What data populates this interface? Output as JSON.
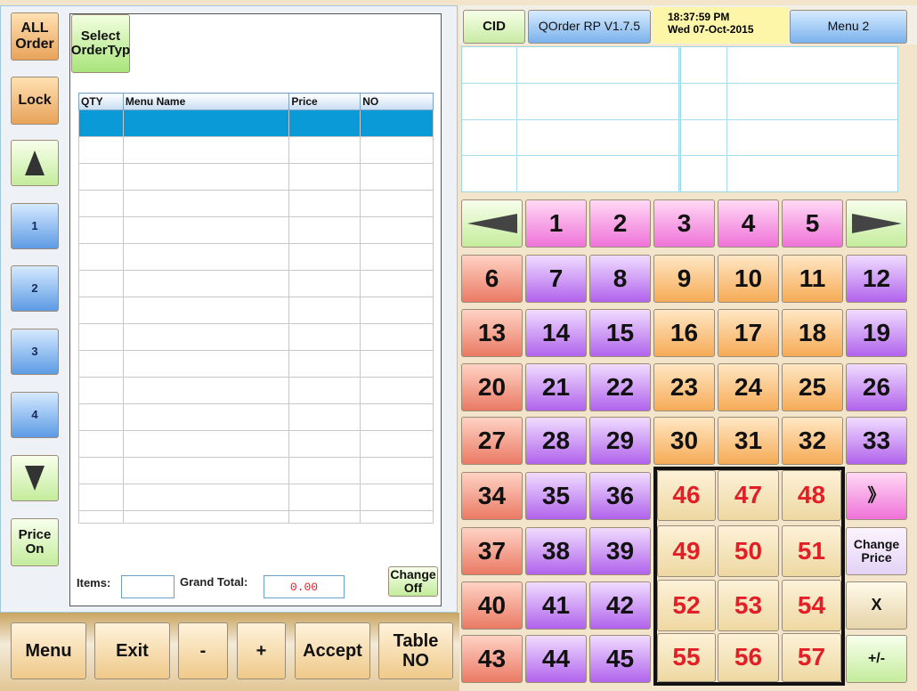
{
  "left_buttons": {
    "all_order": "ALL\nOrder",
    "lock": "Lock",
    "page_1": "1",
    "page_2": "2",
    "page_3": "3",
    "page_4": "4",
    "price_on": "Price\nOn"
  },
  "order": {
    "select_order_type": "Select\nOrderTyp",
    "columns": [
      "QTY",
      "Menu Name",
      "Price",
      "NO"
    ],
    "items_label": "Items:",
    "grand_total_label": "Grand Total:",
    "grand_total_value": "0.00",
    "change_off": "Change\nOff"
  },
  "bottom_buttons": {
    "menu": "Menu",
    "exit": "Exit",
    "minus": "-",
    "plus": "+",
    "accept": "Accept",
    "table_no": "Table\nNO"
  },
  "header": {
    "cid": "CID",
    "version": "QOrder RP V1.7.5",
    "time": "18:37:59 PM",
    "date": "Wed 07-Oct-2015",
    "menu_label": "Menu 2"
  },
  "right_buttons": {
    "more": "》",
    "change_price": "Change\nPrice",
    "x": "X",
    "plus_minus": "+/-"
  },
  "tables": {
    "row1": [
      "1",
      "2",
      "3",
      "4",
      "5"
    ],
    "row2": [
      "6",
      "7",
      "8",
      "9",
      "10",
      "11",
      "12"
    ],
    "row3": [
      "13",
      "14",
      "15",
      "16",
      "17",
      "18",
      "19"
    ],
    "row4": [
      "20",
      "21",
      "22",
      "23",
      "24",
      "25",
      "26"
    ],
    "row5": [
      "27",
      "28",
      "29",
      "30",
      "31",
      "32",
      "33"
    ],
    "row6": [
      "34",
      "35",
      "36",
      "46",
      "47",
      "48"
    ],
    "row7": [
      "37",
      "38",
      "39",
      "49",
      "50",
      "51"
    ],
    "row8": [
      "40",
      "41",
      "42",
      "52",
      "53",
      "54"
    ],
    "row9": [
      "43",
      "44",
      "45",
      "55",
      "56",
      "57"
    ]
  },
  "colors": {
    "pink": "#ef72d8",
    "salmon": "#ea7a64",
    "purple": "#b163ec",
    "orange": "#f6ab56",
    "wheat": "#eed8a2",
    "selected_row": "#0a9ad8"
  }
}
